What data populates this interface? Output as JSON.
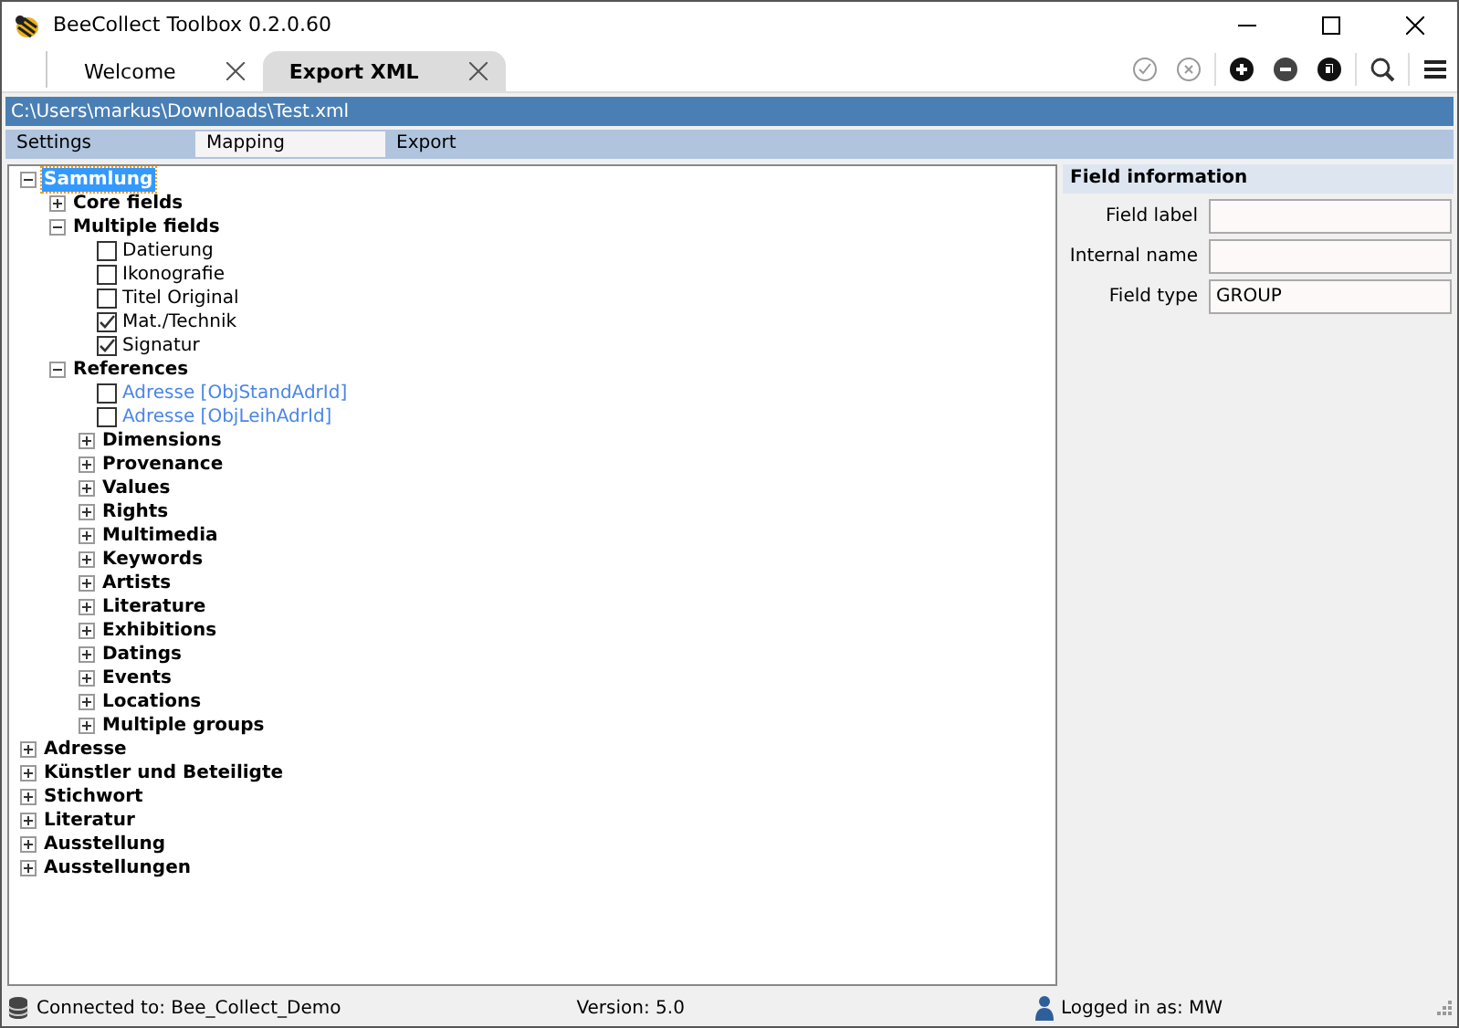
{
  "window": {
    "title": "BeeCollect Toolbox 0.2.0.60"
  },
  "tabs": [
    {
      "label": "Welcome",
      "selected": false
    },
    {
      "label": "Export XML",
      "selected": true
    }
  ],
  "path": "C:\\Users\\markus\\Downloads\\Test.xml",
  "subtabs": [
    {
      "label": "Settings",
      "selected": false
    },
    {
      "label": "Mapping",
      "selected": true
    },
    {
      "label": "Export",
      "selected": false
    }
  ],
  "tree": [
    {
      "kind": "group",
      "label": "Sammlung",
      "expanded": true,
      "selected": true,
      "children": [
        {
          "kind": "group",
          "label": "Core fields",
          "expanded": false,
          "selected": false
        },
        {
          "kind": "group",
          "label": "Multiple fields",
          "expanded": true,
          "selected": false,
          "children": [
            {
              "kind": "field",
              "label": "Datierung",
              "checked": false,
              "selected": false
            },
            {
              "kind": "field",
              "label": "Ikonografie",
              "checked": false,
              "selected": false
            },
            {
              "kind": "field",
              "label": "Titel Original",
              "checked": false,
              "selected": false
            },
            {
              "kind": "field",
              "label": "Mat./Technik",
              "checked": true,
              "selected": false
            },
            {
              "kind": "field",
              "label": "Signatur",
              "checked": true,
              "selected": false
            }
          ]
        },
        {
          "kind": "group",
          "label": "References",
          "expanded": true,
          "selected": false,
          "children": [
            {
              "kind": "reference",
              "label": "Adresse [ObjStandAdrId]",
              "checked": false,
              "selected": false
            },
            {
              "kind": "reference",
              "label": "Adresse [ObjLeihAdrId]",
              "checked": false,
              "selected": false
            },
            {
              "kind": "group",
              "label": "Dimensions",
              "expanded": false,
              "selected": false
            },
            {
              "kind": "group",
              "label": "Provenance",
              "expanded": false,
              "selected": false
            },
            {
              "kind": "group",
              "label": "Values",
              "expanded": false,
              "selected": false
            },
            {
              "kind": "group",
              "label": "Rights",
              "expanded": false,
              "selected": false
            },
            {
              "kind": "group",
              "label": "Multimedia",
              "expanded": false,
              "selected": false
            },
            {
              "kind": "group",
              "label": "Keywords",
              "expanded": false,
              "selected": false
            },
            {
              "kind": "group",
              "label": "Artists",
              "expanded": false,
              "selected": false
            },
            {
              "kind": "group",
              "label": "Literature",
              "expanded": false,
              "selected": false
            },
            {
              "kind": "group",
              "label": "Exhibitions",
              "expanded": false,
              "selected": false
            },
            {
              "kind": "group",
              "label": "Datings",
              "expanded": false,
              "selected": false
            },
            {
              "kind": "group",
              "label": "Events",
              "expanded": false,
              "selected": false
            },
            {
              "kind": "group",
              "label": "Locations",
              "expanded": false,
              "selected": false
            },
            {
              "kind": "group",
              "label": "Multiple groups",
              "expanded": false,
              "selected": false
            }
          ]
        }
      ]
    },
    {
      "kind": "group",
      "label": "Adresse",
      "expanded": false,
      "selected": false
    },
    {
      "kind": "group",
      "label": "Künstler und Beteiligte",
      "expanded": false,
      "selected": false
    },
    {
      "kind": "group",
      "label": "Stichwort",
      "expanded": false,
      "selected": false
    },
    {
      "kind": "group",
      "label": "Literatur",
      "expanded": false,
      "selected": false
    },
    {
      "kind": "group",
      "label": "Ausstellung",
      "expanded": false,
      "selected": false
    },
    {
      "kind": "group",
      "label": "Ausstellungen",
      "expanded": false,
      "selected": false
    }
  ],
  "field_information": {
    "title": "Field information",
    "fields": [
      {
        "label": "Field label"
      },
      {
        "label": "Internal name"
      },
      {
        "label": "Field type",
        "value": "GROUP"
      }
    ]
  },
  "status_bar": {
    "connection": "Connected to: Bee_Collect_Demo",
    "version": "Version: 5.0",
    "user": "Logged in as: MW"
  }
}
